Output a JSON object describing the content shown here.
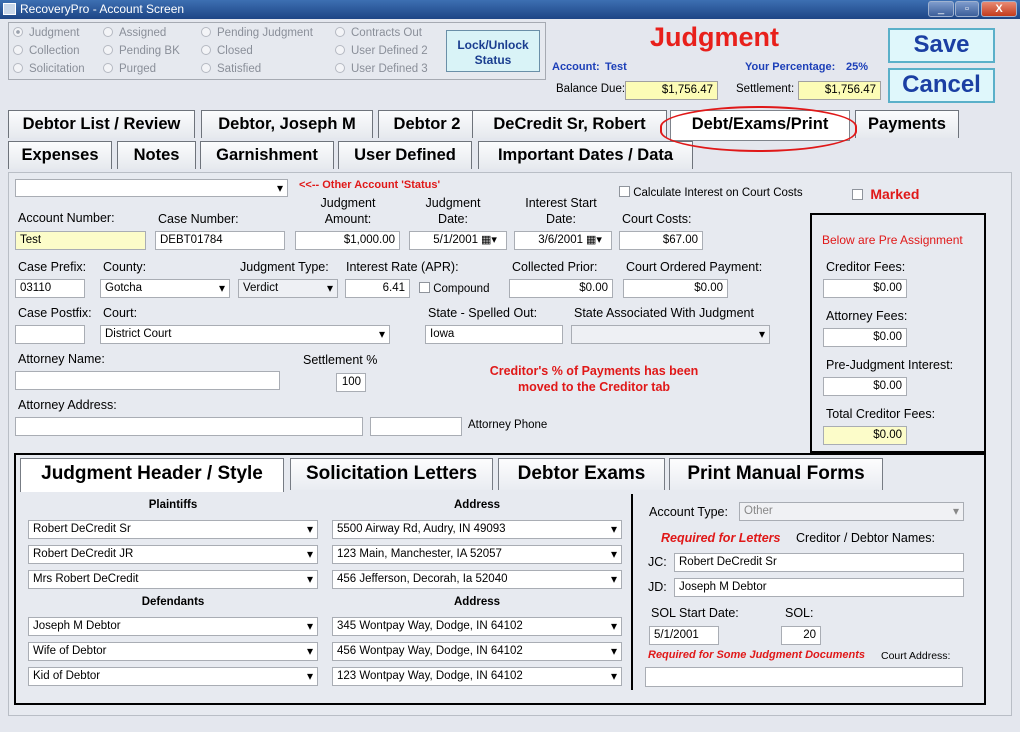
{
  "window": {
    "title": "RecoveryPro - Account Screen"
  },
  "status_options": [
    {
      "label": "Judgment",
      "selected": true
    },
    {
      "label": "Assigned"
    },
    {
      "label": "Pending Judgment"
    },
    {
      "label": "Contracts Out"
    },
    {
      "label": "Collection"
    },
    {
      "label": "Pending BK"
    },
    {
      "label": "Closed"
    },
    {
      "label": "User Defined 2"
    },
    {
      "label": "Solicitation"
    },
    {
      "label": "Purged"
    },
    {
      "label": "Satisfied"
    },
    {
      "label": "User Defined 3"
    }
  ],
  "lock_button": {
    "line1": "Lock/Unlock",
    "line2": "Status"
  },
  "header": {
    "status_title": "Judgment",
    "account_label": "Account:",
    "account_value": "Test",
    "percentage_label": "Your Percentage:",
    "percentage_value": "25%",
    "balance_label": "Balance Due:",
    "balance_value": "$1,756.47",
    "settlement_label": "Settlement:",
    "settlement_value": "$1,756.47"
  },
  "actions": {
    "save": "Save",
    "cancel": "Cancel"
  },
  "tabs_row1": [
    "Debtor List / Review",
    "Debtor, Joseph M",
    "Debtor 2",
    "DeCredit Sr, Robert",
    "Debt/Exams/Print",
    "Payments"
  ],
  "tabs_row2": [
    "Expenses",
    "Notes",
    "Garnishment",
    "User Defined",
    "Important Dates / Data"
  ],
  "form": {
    "other_status_note": "<<-- Other Account 'Status'",
    "calc_interest_label": "Calculate Interest on Court Costs",
    "marked_label": "Marked",
    "account_number": {
      "label": "Account Number:",
      "value": "Test"
    },
    "case_number": {
      "label": "Case Number:",
      "value": "DEBT01784"
    },
    "judgment_amount": {
      "label1": "Judgment",
      "label2": "Amount:",
      "value": "$1,000.00"
    },
    "judgment_date": {
      "label1": "Judgment",
      "label2": "Date:",
      "value": "5/1/2001"
    },
    "interest_start": {
      "label1": "Interest Start",
      "label2": "Date:",
      "value": "3/6/2001"
    },
    "court_costs": {
      "label": "Court Costs:",
      "value": "$67.00"
    },
    "case_prefix": {
      "label": "Case Prefix:",
      "value": "03110"
    },
    "county": {
      "label": "County:",
      "value": "Gotcha"
    },
    "judgment_type": {
      "label": "Judgment Type:",
      "value": "Verdict"
    },
    "interest_rate": {
      "label": "Interest Rate (APR):",
      "value": "6.41"
    },
    "compound_label": "Compound",
    "collected_prior": {
      "label": "Collected  Prior:",
      "value": "$0.00"
    },
    "court_ordered": {
      "label": "Court Ordered Payment:",
      "value": "$0.00"
    },
    "case_postfix": {
      "label": "Case Postfix:",
      "value": ""
    },
    "court": {
      "label": "Court:",
      "value": "District Court"
    },
    "state_spelled": {
      "label": "State - Spelled Out:",
      "value": "Iowa"
    },
    "state_assoc": {
      "label": "State Associated With Judgment",
      "value": ""
    },
    "attorney_name": {
      "label": "Attorney Name:",
      "value": ""
    },
    "settlement_pct": {
      "label": "Settlement %",
      "value": "100"
    },
    "creditor_note_line1": "Creditor's % of Payments has been",
    "creditor_note_line2": "moved to the Creditor tab",
    "attorney_address": {
      "label": "Attorney Address:",
      "value": ""
    },
    "attorney_phone_label": "Attorney Phone"
  },
  "pre_assignment": {
    "title": "Below are Pre Assignment",
    "creditor_fees": {
      "label": "Creditor Fees:",
      "value": "$0.00"
    },
    "attorney_fees": {
      "label": "Attorney Fees:",
      "value": "$0.00"
    },
    "prejudgment_interest": {
      "label": "Pre-Judgment Interest:",
      "value": "$0.00"
    },
    "total_creditor_fees": {
      "label": "Total Creditor Fees:",
      "value": "$0.00"
    }
  },
  "subtabs": [
    "Judgment Header / Style",
    "Solicitation Letters",
    "Debtor Exams",
    "Print Manual Forms"
  ],
  "style": {
    "plaintiffs_header": "Plaintiffs",
    "address_header": "Address",
    "defendants_header": "Defendants",
    "plaintiffs": [
      {
        "name": "Robert DeCredit Sr",
        "address": "5500 Airway Rd, Audry, IN 49093"
      },
      {
        "name": "Robert DeCredit JR",
        "address": "123 Main, Manchester, IA 52057"
      },
      {
        "name": "Mrs Robert DeCredit",
        "address": "456 Jefferson, Decorah, Ia 52040"
      }
    ],
    "defendants": [
      {
        "name": "Joseph M Debtor",
        "address": "345 Wontpay Way, Dodge, IN 64102"
      },
      {
        "name": "Wife of Debtor",
        "address": "456 Wontpay Way, Dodge, IN 64102"
      },
      {
        "name": "Kid of Debtor",
        "address": "123 Wontpay Way, Dodge, IN 64102"
      }
    ],
    "account_type": {
      "label": "Account Type:",
      "value": "Other"
    },
    "required_letters": "Required for Letters",
    "names_label": "Creditor / Debtor Names:",
    "jc": {
      "label": "JC:",
      "value": "Robert DeCredit Sr"
    },
    "jd": {
      "label": "JD:",
      "value": "Joseph M Debtor"
    },
    "sol_start": {
      "label": "SOL Start Date:",
      "value": "5/1/2001"
    },
    "sol": {
      "label": "SOL:",
      "value": "20"
    },
    "required_docs": "Required for Some Judgment Documents",
    "court_address_label": "Court Address:"
  }
}
